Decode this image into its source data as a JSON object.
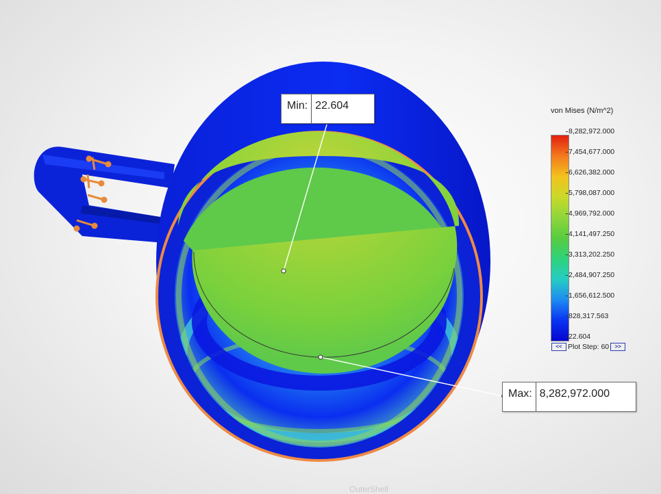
{
  "result_plot": {
    "min_label": "Min:",
    "min_value": "22.604",
    "max_label": "Max:",
    "max_value": "8,282,972.000"
  },
  "legend": {
    "title": "von Mises (N/m^2)",
    "ticks": [
      "8,282,972.000",
      "7,454,677.000",
      "6,626,382.000",
      "5,798,087.000",
      "4,969,792.000",
      "4,141,497.250",
      "3,313,202.250",
      "2,484,907.250",
      "1,656,612.500",
      "828,317.563",
      "22.604"
    ],
    "plot_step_label": "Plot Step: 60",
    "prev_button": "<<",
    "next_button": ">>"
  },
  "bottom_tab_label": "OuterShell",
  "colors": {
    "shell_blue": "#0a1fe0",
    "rim_orange": "#ee8a45",
    "contour_green": "#74d23a",
    "fixture_orange": "#e88a3a"
  }
}
